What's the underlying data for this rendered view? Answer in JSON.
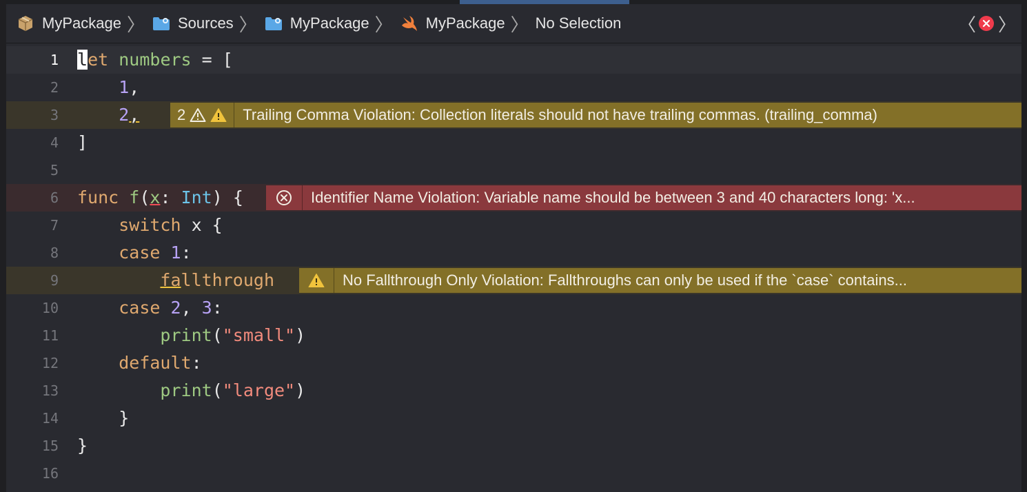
{
  "breadcrumbs": [
    {
      "label": "MyPackage",
      "icon": "package-icon"
    },
    {
      "label": "Sources",
      "icon": "folder-icon"
    },
    {
      "label": "MyPackage",
      "icon": "folder-icon"
    },
    {
      "label": "MyPackage",
      "icon": "swift-icon"
    },
    {
      "label": "No Selection"
    }
  ],
  "lines": {
    "n1": "1",
    "n2": "2",
    "n3": "3",
    "n4": "4",
    "n5": "5",
    "n6": "6",
    "n7": "7",
    "n8": "8",
    "n9": "9",
    "n10": "10",
    "n11": "11",
    "n12": "12",
    "n13": "13",
    "n14": "14",
    "n15": "15",
    "n16": "16"
  },
  "code": {
    "l1_cursor_char": "l",
    "l1_kw_rest": "et",
    "l1_name": "numbers",
    "l1_rest": " = [",
    "l2_num": "1",
    "l2_rest": ",",
    "l3_num": "2",
    "l3_rest": ",",
    "l4": "]",
    "l6_kw": "func",
    "l6_fname": "f",
    "l6_open": "(",
    "l6_param": "x",
    "l6_colon": ": ",
    "l6_type": "Int",
    "l6_rest": ") {",
    "l7_kw": "switch",
    "l7_rest": " x {",
    "l8_kw": "case",
    "l8_num": "1",
    "l8_rest": ":",
    "l9_kw_u": "fa",
    "l9_kw": "llthrough",
    "l10_kw": "case",
    "l10_n1": "2",
    "l10_comma": ", ",
    "l10_n2": "3",
    "l10_rest": ":",
    "l11_fn": "print",
    "l11_open": "(",
    "l11_str": "\"small\"",
    "l11_close": ")",
    "l12_kw": "default",
    "l12_rest": ":",
    "l13_fn": "print",
    "l13_open": "(",
    "l13_str": "\"large\"",
    "l13_close": ")",
    "l14": "}",
    "l15": "}"
  },
  "issues": {
    "trailing_comma": {
      "count": "2",
      "message": "Trailing Comma Violation: Collection literals should not have trailing commas. (trailing_comma)",
      "severity": "warning"
    },
    "identifier_name": {
      "message": "Identifier Name Violation: Variable name should be between 3 and 40 characters long: 'x...",
      "severity": "error"
    },
    "fallthrough": {
      "message": "No Fallthrough Only Violation: Fallthroughs can only be used if the `case` contains...",
      "severity": "warning"
    }
  },
  "colors": {
    "warning_banner": "#837028",
    "error_banner": "#8a393d",
    "error_icon": "#ef3b4c",
    "warning_icon": "#f0c33c"
  }
}
